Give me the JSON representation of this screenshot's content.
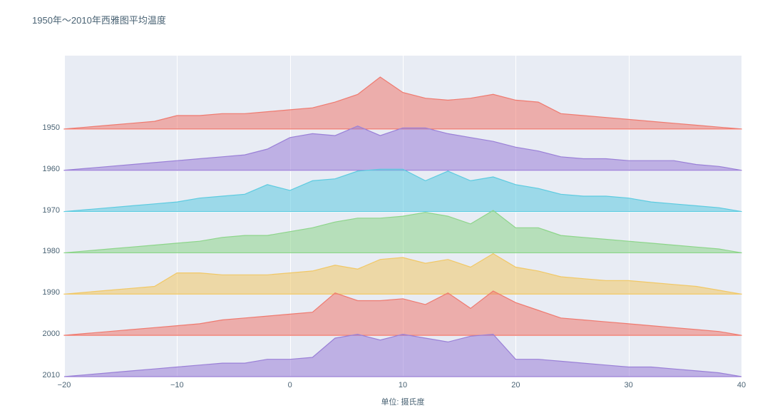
{
  "title": "1950年～2010年西雅图平均温度",
  "x_axis": {
    "label": "单位: 摄氏度",
    "range": [
      -20,
      40
    ],
    "ticks": [
      -20,
      -10,
      0,
      10,
      20,
      30,
      40
    ]
  },
  "y_ticks": [
    "1950",
    "1960",
    "1970",
    "1980",
    "1990",
    "2000",
    "2010"
  ],
  "colors": [
    "#ef7a6f",
    "#9a80d7",
    "#5dcbe0",
    "#8dd58a",
    "#f1c866",
    "#ef7a6f",
    "#9a80d7"
  ],
  "chart_data": {
    "type": "ridgeline",
    "title": "1950年～2010年西雅图平均温度",
    "xlabel": "单位: 摄氏度",
    "ylabel": "",
    "xlim": [
      -20,
      40
    ],
    "x": [
      -20,
      -18,
      -16,
      -14,
      -12,
      -10,
      -8,
      -6,
      -4,
      -2,
      0,
      2,
      4,
      6,
      8,
      10,
      12,
      14,
      16,
      18,
      20,
      22,
      24,
      26,
      28,
      30,
      32,
      34,
      36,
      38,
      40
    ],
    "series": [
      {
        "name": "1950",
        "color": "#ef7a6f",
        "values": [
          0,
          1,
          2,
          3,
          4,
          7,
          7,
          8,
          8,
          9,
          10,
          11,
          14,
          18,
          27,
          19,
          16,
          15,
          16,
          18,
          15,
          14,
          8,
          7,
          6,
          5,
          4,
          3,
          2,
          1,
          0
        ]
      },
      {
        "name": "1960",
        "color": "#9a80d7",
        "values": [
          0,
          1,
          2,
          3,
          4,
          5,
          6,
          7,
          8,
          11,
          17,
          19,
          18,
          23,
          18,
          22,
          22,
          19,
          17,
          15,
          12,
          10,
          7,
          6,
          6,
          5,
          5,
          5,
          3,
          2,
          0
        ]
      },
      {
        "name": "1970",
        "color": "#5dcbe0",
        "values": [
          0,
          1,
          2,
          3,
          4,
          5,
          7,
          8,
          9,
          14,
          11,
          16,
          17,
          21,
          22,
          22,
          16,
          21,
          16,
          18,
          14,
          12,
          9,
          8,
          8,
          7,
          5,
          4,
          3,
          2,
          0
        ]
      },
      {
        "name": "1980",
        "color": "#8dd58a",
        "values": [
          0,
          1,
          2,
          3,
          4,
          5,
          6,
          8,
          9,
          9,
          11,
          13,
          16,
          18,
          18,
          19,
          21,
          19,
          15,
          22,
          13,
          13,
          9,
          8,
          7,
          6,
          5,
          4,
          3,
          2,
          0
        ]
      },
      {
        "name": "1990",
        "color": "#f1c866",
        "values": [
          0,
          1,
          2,
          3,
          4,
          11,
          11,
          10,
          10,
          10,
          11,
          12,
          15,
          13,
          18,
          19,
          16,
          18,
          14,
          21,
          14,
          12,
          9,
          8,
          7,
          7,
          6,
          5,
          4,
          2,
          0
        ]
      },
      {
        "name": "2000",
        "color": "#ef7a6f",
        "values": [
          0,
          1,
          2,
          3,
          4,
          5,
          6,
          8,
          9,
          10,
          11,
          12,
          22,
          18,
          18,
          19,
          16,
          22,
          14,
          23,
          17,
          13,
          9,
          8,
          7,
          6,
          5,
          4,
          3,
          2,
          0
        ]
      },
      {
        "name": "2010",
        "color": "#9a80d7",
        "values": [
          0,
          1,
          2,
          3,
          4,
          5,
          6,
          7,
          7,
          9,
          9,
          10,
          20,
          22,
          19,
          22,
          20,
          18,
          21,
          22,
          9,
          9,
          8,
          7,
          6,
          5,
          5,
          4,
          3,
          2,
          0
        ]
      }
    ]
  }
}
